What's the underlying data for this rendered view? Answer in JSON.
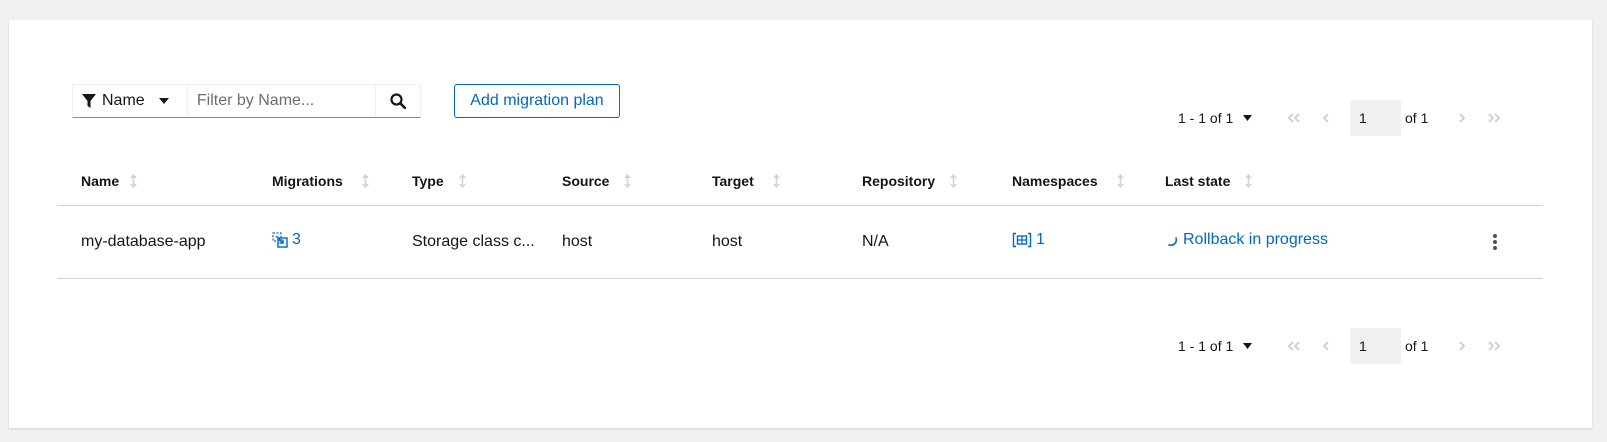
{
  "toolbar": {
    "filter_label": "Name",
    "filter_placeholder": "Filter by Name...",
    "filter_value": "",
    "add_button_label": "Add migration plan"
  },
  "pagination": {
    "range_label": "1 - 1 of 1",
    "page": "1",
    "of_total": "of 1"
  },
  "table": {
    "columns": [
      "Name",
      "Migrations",
      "Type",
      "Source",
      "Target",
      "Repository",
      "Namespaces",
      "Last state"
    ],
    "rows": [
      {
        "name": "my-database-app",
        "migrations": "3",
        "type": "Storage class c...",
        "source": "host",
        "target": "host",
        "repository": "N/A",
        "namespaces": "1",
        "last_state": "Rollback in progress"
      }
    ]
  },
  "colors": {
    "link": "#0066cc",
    "border": "#d2d2d2",
    "disabled": "#d2d2d2"
  }
}
